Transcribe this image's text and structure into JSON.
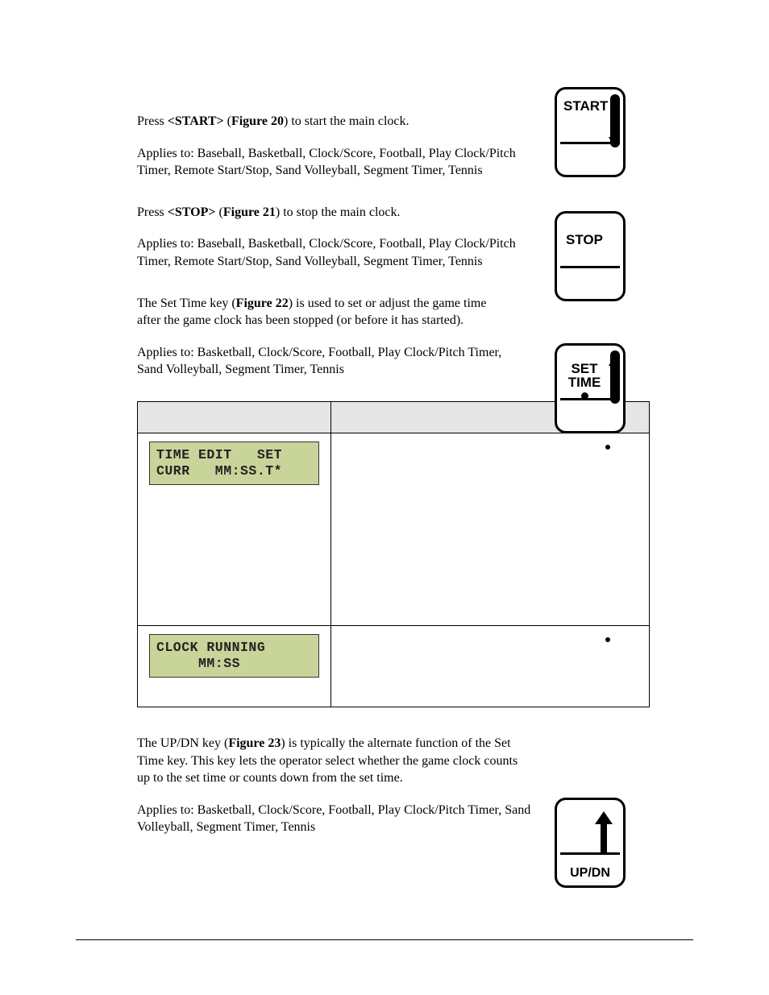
{
  "start_section": {
    "line1_pre": "Press ",
    "key_bold": "<START>",
    "line1_mid": " (",
    "fig_bold": "Figure 20",
    "line1_post": ") to start the main clock.",
    "applies": "Applies to: Baseball, Basketball, Clock/Score, Football, Play Clock/Pitch Timer, Remote Start/Stop, Sand Volleyball, Segment Timer, Tennis",
    "key_label": "START"
  },
  "stop_section": {
    "line1_pre": "Press ",
    "key_bold": "<STOP>",
    "line1_mid": " (",
    "fig_bold": "Figure 21",
    "line1_post": ") to stop the main clock.",
    "applies": "Applies to: Baseball, Basketball, Clock/Score, Football, Play Clock/Pitch Timer, Remote Start/Stop, Sand Volleyball, Segment Timer, Tennis",
    "key_label": "STOP"
  },
  "settime_section": {
    "line1_pre": "The Set Time key (",
    "fig_bold": "Figure 22",
    "line1_post": ") is used to set or adjust the game time after the game clock has been stopped (or before it has started).",
    "applies": "Applies to: Basketball, Clock/Score, Football, Play Clock/Pitch Timer, Sand Volleyball, Segment Timer, Tennis",
    "key_label_line1": "SET",
    "key_label_line2": "TIME"
  },
  "table": {
    "header_lcd": "",
    "header_action": "",
    "row1": {
      "lcd_line1": "TIME EDIT   SET",
      "lcd_line2": "CURR   MM:SS.T*",
      "action": ""
    },
    "row2": {
      "lcd_line1": "CLOCK RUNNING",
      "lcd_line2": "     MM:SS",
      "action": ""
    }
  },
  "updn_section": {
    "line1_pre": "The UP/DN key (",
    "fig_bold": "Figure 23",
    "line1_post": ") is typically the alternate function of the Set Time key. This key lets the operator select whether the game clock counts up to the set time or counts down from the set time.",
    "applies": "Applies to: Basketball, Clock/Score, Football, Play Clock/Pitch Timer, Sand Volleyball, Segment Timer, Tennis",
    "key_label": "UP/DN"
  }
}
